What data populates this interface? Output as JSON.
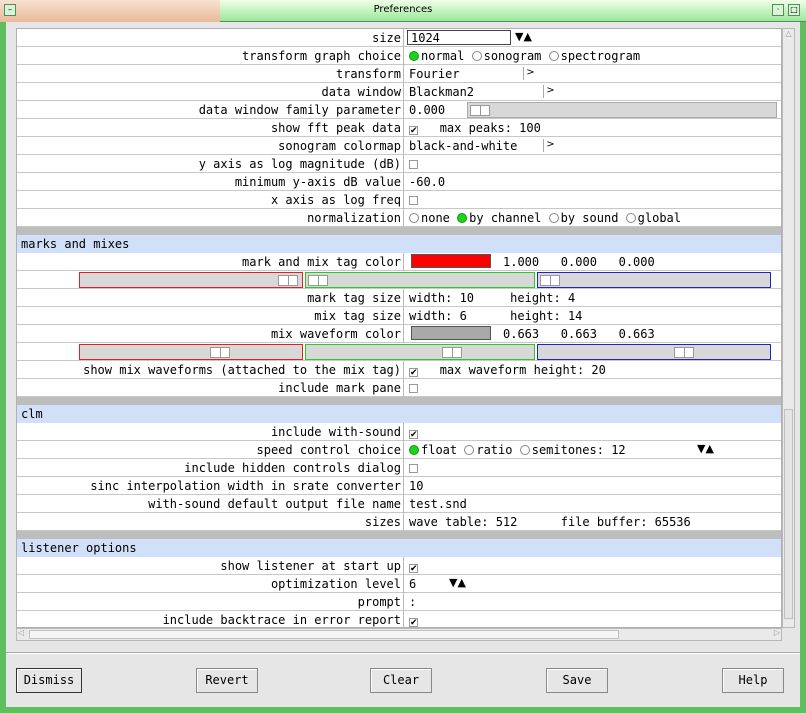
{
  "window": {
    "title": "Preferences"
  },
  "fft": {
    "size_label": "size",
    "size_value": "1024",
    "graph_label": "transform graph choice",
    "graph_options": [
      "normal",
      "sonogram",
      "spectrogram"
    ],
    "transform_label": "transform",
    "transform_value": "Fourier",
    "window_label": "data window",
    "window_value": "Blackman2",
    "family_label": "data window family parameter",
    "family_value": "0.000",
    "peak_label": "show fft peak data",
    "peak_extra": "max peaks: 100",
    "colormap_label": "sonogram colormap",
    "colormap_value": "black-and-white",
    "ylog_label": "y axis as log magnitude (dB)",
    "mindb_label": "minimum y-axis dB value",
    "mindb_value": "-60.0",
    "xlog_label": "x axis as log freq",
    "norm_label": "normalization",
    "norm_options": [
      "none",
      "by channel",
      "by sound",
      "global"
    ]
  },
  "marks": {
    "section": "marks and mixes",
    "tagcolor_label": "mark and mix tag color",
    "tagcolor_rgb": "1.000   0.000   0.000",
    "tagcolor": "#ff0000",
    "marksize_label": "mark tag size",
    "marksize_value": "width: 10     height: 4",
    "mixsize_label": "mix tag size",
    "mixsize_value": "width: 6      height: 14",
    "mixcolor_label": "mix waveform color",
    "mixcolor_rgb": "0.663   0.663   0.663",
    "mixcolor": "#a9a9a9",
    "showmix_label": "show mix waveforms (attached to the mix tag)",
    "showmix_extra": "max waveform height: 20",
    "markpane_label": "include mark pane"
  },
  "clm": {
    "section": "clm",
    "withsound_label": "include with-sound",
    "speed_label": "speed control choice",
    "speed_options": [
      "float",
      "ratio",
      "semitones: 12"
    ],
    "hidden_label": "include hidden controls dialog",
    "sinc_label": "sinc interpolation width in srate converter",
    "sinc_value": "10",
    "outfile_label": "with-sound default output file name",
    "outfile_value": "test.snd",
    "sizes_label": "sizes",
    "sizes_value": "wave table: 512      file buffer: 65536"
  },
  "listener": {
    "section": "listener options",
    "startup_label": "show listener at start up",
    "opt_label": "optimization level",
    "opt_value": "6",
    "prompt_label": "prompt",
    "prompt_value": ":",
    "backtrace_label": "include backtrace in error report"
  },
  "buttons": {
    "dismiss": "Dismiss",
    "revert": "Revert",
    "clear": "Clear",
    "save": "Save",
    "help": "Help"
  }
}
